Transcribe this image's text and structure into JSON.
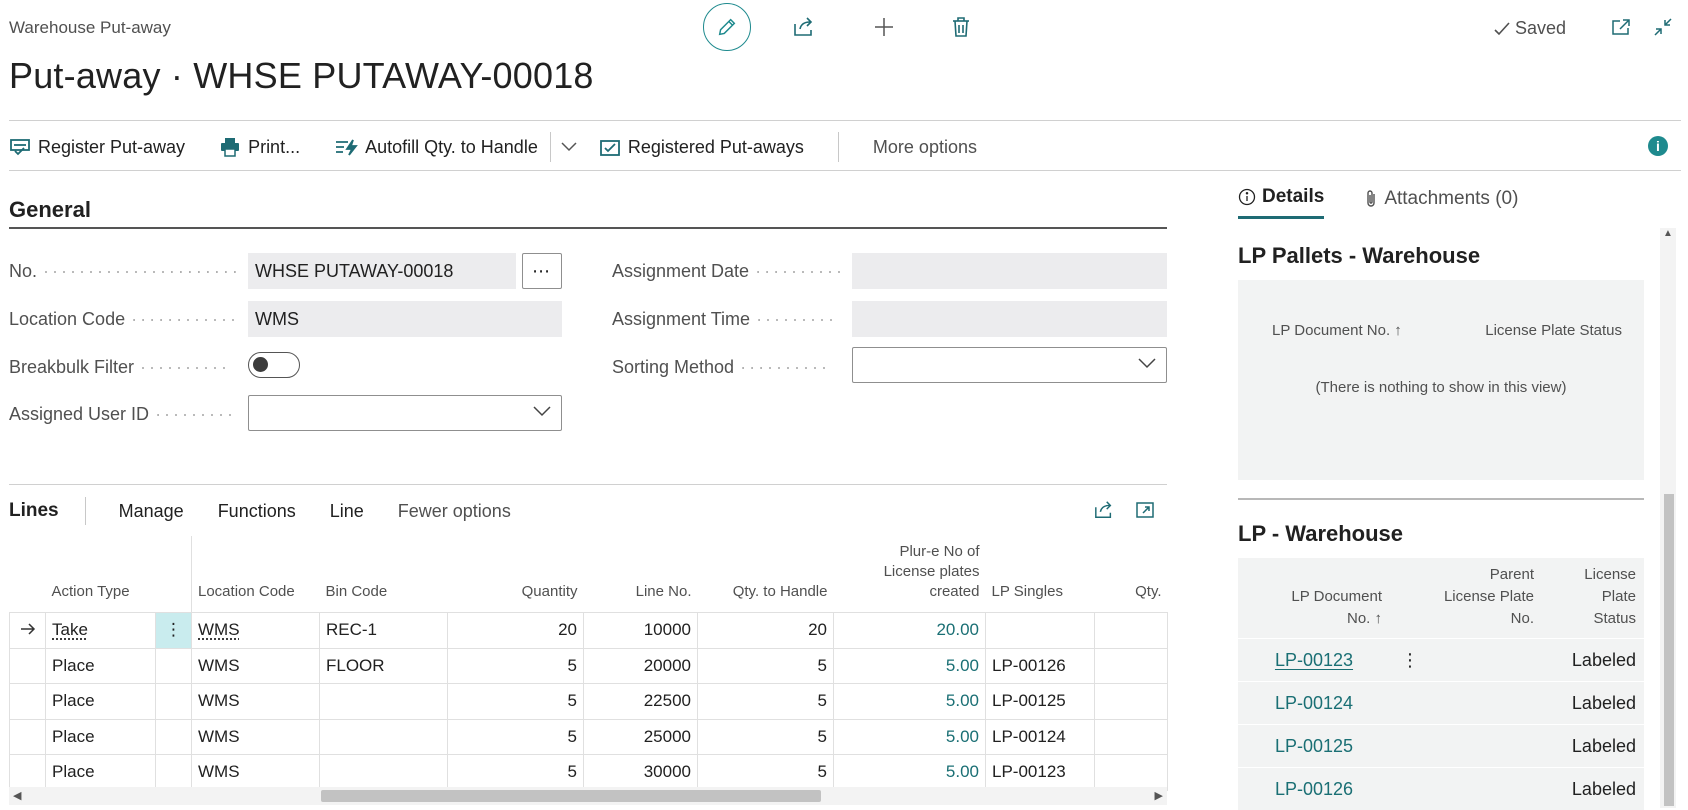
{
  "header": {
    "caption": "Warehouse Put-away",
    "title": "Put-away · WHSE PUTAWAY-00018",
    "saved_label": "Saved"
  },
  "action_bar": {
    "register": "Register Put-away",
    "print": "Print...",
    "autofill": "Autofill Qty. to Handle",
    "registered": "Registered Put-aways",
    "more": "More options"
  },
  "general": {
    "title": "General",
    "no_label": "No.",
    "no_value": "WHSE PUTAWAY-00018",
    "location_label": "Location Code",
    "location_value": "WMS",
    "breakbulk_label": "Breakbulk Filter",
    "breakbulk_on": false,
    "assigned_user_label": "Assigned User ID",
    "assigned_user_value": "",
    "assignment_date_label": "Assignment Date",
    "assignment_date_value": "",
    "assignment_time_label": "Assignment Time",
    "assignment_time_value": "",
    "sorting_label": "Sorting Method",
    "sorting_value": ""
  },
  "lines": {
    "title": "Lines",
    "menu": [
      "Manage",
      "Functions",
      "Line",
      "Fewer options"
    ],
    "columns": {
      "action_type": "Action Type",
      "location": "Location Code",
      "bin": "Bin Code",
      "quantity": "Quantity",
      "line_no": "Line No.",
      "qty_to_handle": "Qty. to Handle",
      "plur_line1": "Plur-e No of",
      "plur_line2": "License plates",
      "plur_line3": "created",
      "lp_singles": "LP Singles",
      "qty": "Qty."
    },
    "rows": [
      {
        "action": "Take",
        "location": "WMS",
        "bin": "REC-1",
        "quantity": "20",
        "line_no": "10000",
        "qty_to_handle": "20",
        "plur": "20.00",
        "lp": ""
      },
      {
        "action": "Place",
        "location": "WMS",
        "bin": "FLOOR",
        "quantity": "5",
        "line_no": "20000",
        "qty_to_handle": "5",
        "plur": "5.00",
        "lp": "LP-00126"
      },
      {
        "action": "Place",
        "location": "WMS",
        "bin": "",
        "quantity": "5",
        "line_no": "22500",
        "qty_to_handle": "5",
        "plur": "5.00",
        "lp": "LP-00125"
      },
      {
        "action": "Place",
        "location": "WMS",
        "bin": "",
        "quantity": "5",
        "line_no": "25000",
        "qty_to_handle": "5",
        "plur": "5.00",
        "lp": "LP-00124"
      },
      {
        "action": "Place",
        "location": "WMS",
        "bin": "",
        "quantity": "5",
        "line_no": "30000",
        "qty_to_handle": "5",
        "plur": "5.00",
        "lp": "LP-00123"
      }
    ]
  },
  "factbox": {
    "tab_details": "Details",
    "tab_attachments": "Attachments (0)",
    "pallets": {
      "title": "LP Pallets - Warehouse",
      "col_doc": "LP Document No.",
      "col_status": "License Plate Status",
      "empty": "(There is nothing to show in this view)"
    },
    "lp_wh": {
      "title": "LP - Warehouse",
      "col_doc_1": "LP Document",
      "col_doc_2": "No.",
      "col_parent_1": "Parent",
      "col_parent_2": "License Plate",
      "col_parent_3": "No.",
      "col_status_1": "License Plate",
      "col_status_2": "Status",
      "rows": [
        {
          "doc": "LP-00123",
          "status": "Labeled"
        },
        {
          "doc": "LP-00124",
          "status": "Labeled"
        },
        {
          "doc": "LP-00125",
          "status": "Labeled"
        },
        {
          "doc": "LP-00126",
          "status": "Labeled"
        }
      ]
    }
  },
  "colors": {
    "accent": "#1e8a8e",
    "link": "#1a6f74",
    "selection": "#c9ecee"
  }
}
